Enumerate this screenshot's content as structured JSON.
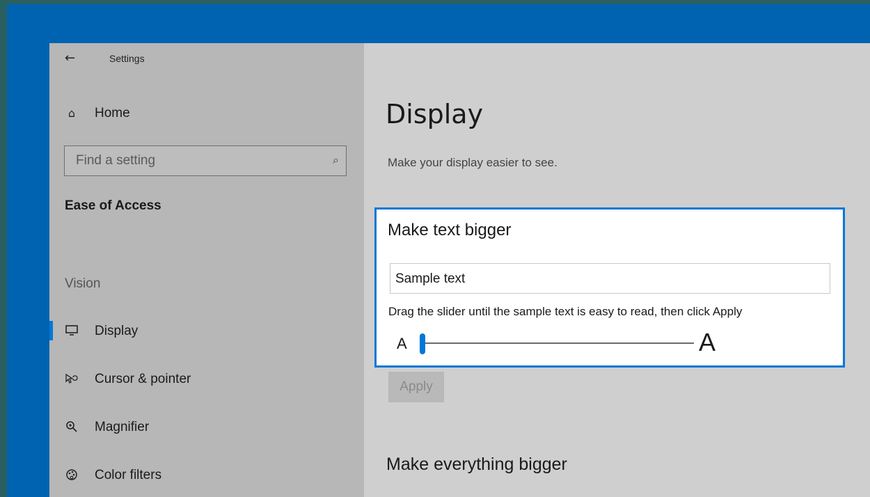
{
  "window": {
    "title": "Settings"
  },
  "sidebar": {
    "home_label": "Home",
    "search_placeholder": "Find a setting",
    "section_heading": "Ease of Access",
    "group_label": "Vision",
    "items": [
      {
        "label": "Display",
        "icon": "monitor-icon",
        "active": true
      },
      {
        "label": "Cursor & pointer",
        "icon": "cursor-icon",
        "active": false
      },
      {
        "label": "Magnifier",
        "icon": "magnifier-icon",
        "active": false
      },
      {
        "label": "Color filters",
        "icon": "color-filter-icon",
        "active": false
      }
    ]
  },
  "main": {
    "title": "Display",
    "subtitle": "Make your display easier to see.",
    "text_size": {
      "heading": "Make text bigger",
      "sample_text": "Sample text",
      "instructions": "Drag the slider until the sample text is easy to read, then click Apply",
      "slider_min_label": "A",
      "slider_max_label": "A",
      "slider_value_percent": 0
    },
    "apply_label": "Apply",
    "section2_heading": "Make everything bigger"
  },
  "colors": {
    "accent": "#0078d7",
    "frame_blue": "#0063b1",
    "sidebar_bg": "#b7b7b7",
    "content_bg": "#cfcfcf"
  }
}
